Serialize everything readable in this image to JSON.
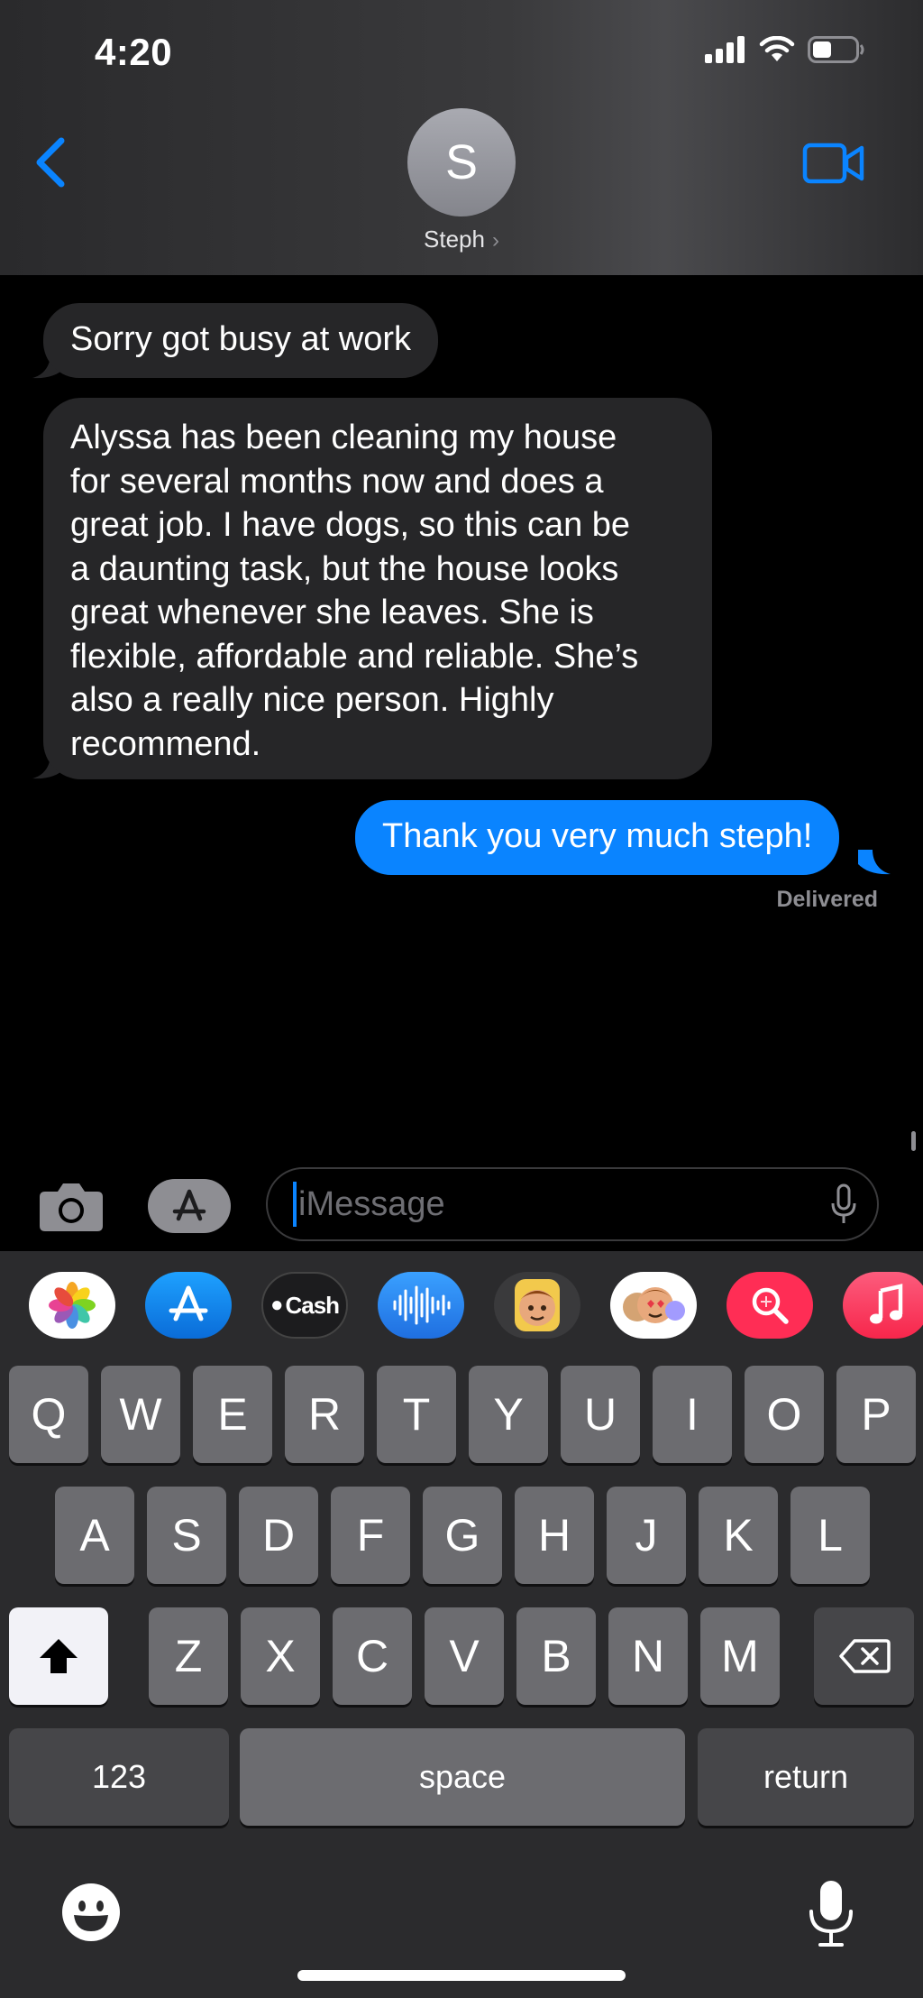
{
  "status_bar": {
    "time": "4:20"
  },
  "header": {
    "contact_initial": "S",
    "contact_name": "Steph",
    "chevron": "›",
    "icons": {
      "back": "chevron-left-icon",
      "video": "video-camera-icon"
    },
    "accent_color": "#0a84ff"
  },
  "messages": [
    {
      "direction": "incoming",
      "text": "Sorry got busy at work"
    },
    {
      "direction": "incoming",
      "lines": [
        "Alyssa has been cleaning my house",
        "for several months now and does a",
        "great job. I have dogs, so this can be",
        "a daunting task, but the house looks",
        "great whenever she leaves. She is",
        "flexible, affordable and reliable. She’s",
        "also a really nice person. Highly",
        "recommend."
      ]
    },
    {
      "direction": "outgoing",
      "text": "Thank you very much steph!"
    }
  ],
  "delivery_status": "Delivered",
  "input": {
    "placeholder": "iMessage"
  },
  "app_strip": {
    "apps": [
      "photos-app-icon",
      "app-store-icon",
      "apple-cash-icon",
      "audio-message-icon",
      "memoji-icon",
      "memoji-stickers-icon",
      "image-search-icon",
      "music-icon"
    ],
    "cash_label": "Cash"
  },
  "keyboard": {
    "row1": [
      "Q",
      "W",
      "E",
      "R",
      "T",
      "Y",
      "U",
      "I",
      "O",
      "P"
    ],
    "row2": [
      "A",
      "S",
      "D",
      "F",
      "G",
      "H",
      "J",
      "K",
      "L"
    ],
    "row3": [
      "Z",
      "X",
      "C",
      "V",
      "B",
      "N",
      "M"
    ],
    "numbers_label": "123",
    "space_label": "space",
    "return_label": "return"
  },
  "colors": {
    "incoming_bubble": "#262628",
    "outgoing_bubble": "#0a84ff",
    "key": "#6c6c70",
    "key_dark": "#464649",
    "keyboard_bg": "#2b2b2d"
  }
}
